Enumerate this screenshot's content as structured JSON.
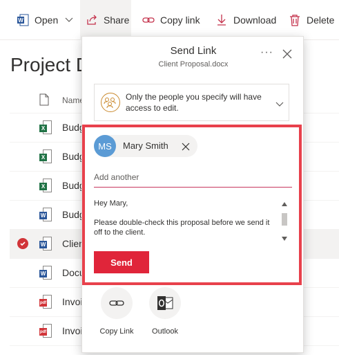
{
  "toolbar": {
    "open_label": "Open",
    "share_label": "Share",
    "copy_link_label": "Copy link",
    "download_label": "Download",
    "delete_label": "Delete"
  },
  "library": {
    "title": "Project D",
    "name_header": "Name",
    "files": [
      {
        "name": "Budg",
        "type": "xlsx",
        "selected": false
      },
      {
        "name": "Budg",
        "type": "xlsx",
        "selected": false
      },
      {
        "name": "Budg",
        "type": "xlsx",
        "selected": false
      },
      {
        "name": "Budg",
        "type": "docx",
        "selected": false
      },
      {
        "name": "Clien",
        "type": "docx",
        "selected": true
      },
      {
        "name": "Docu",
        "type": "docx",
        "selected": false
      },
      {
        "name": "Invoi",
        "type": "pdf",
        "selected": false
      },
      {
        "name": "Invoi",
        "type": "pdf",
        "selected": false
      }
    ]
  },
  "panel": {
    "title": "Send Link",
    "subtitle": "Client Proposal.docx",
    "permission_text": "Only the people you specify will have access to edit.",
    "recipient": {
      "initials": "MS",
      "name": "Mary Smith"
    },
    "add_placeholder": "Add another",
    "message": "Hey Mary,\n\nPlease double-check this proposal before we send it off to the client.",
    "send_label": "Send",
    "options": [
      {
        "label": "Copy Link",
        "icon": "link-icon"
      },
      {
        "label": "Outlook",
        "icon": "outlook-icon"
      }
    ]
  },
  "colors": {
    "accent": "#e0253a",
    "highlight_border": "#e8414c",
    "avatar": "#5b9bd5",
    "excel": "#217346",
    "word": "#2b579a",
    "pdf": "#d13438"
  }
}
